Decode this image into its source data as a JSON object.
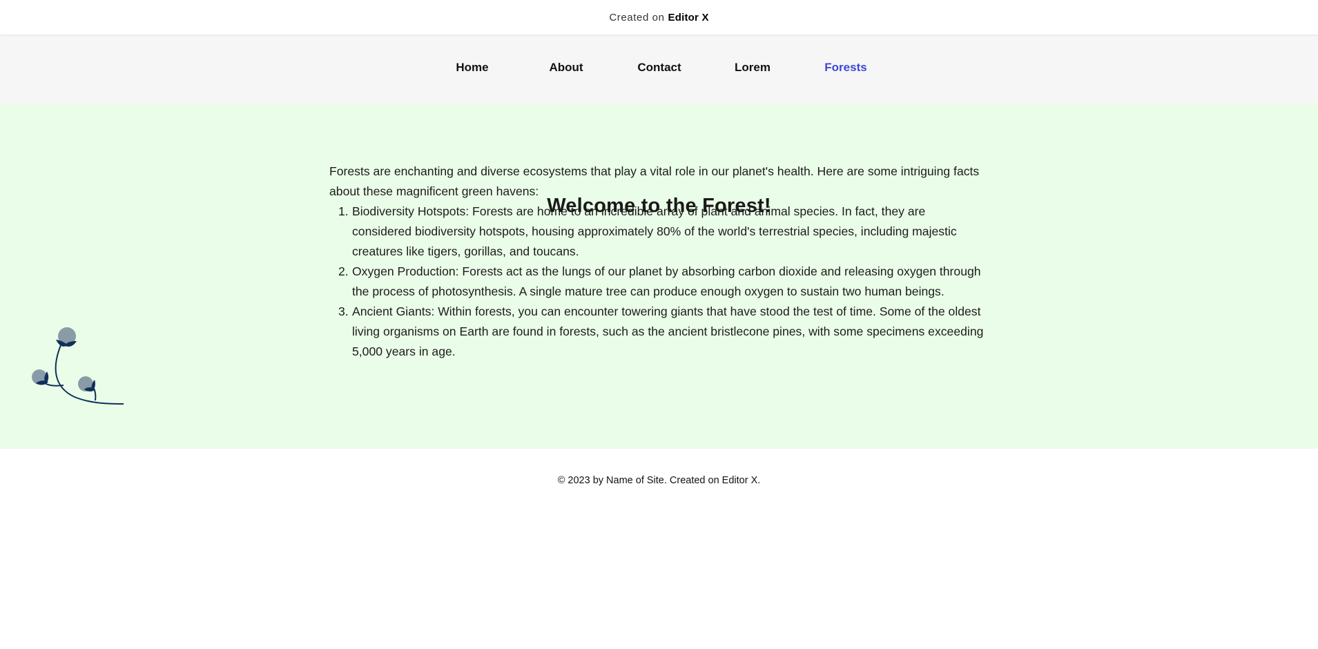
{
  "topbar": {
    "created_on": "Created on",
    "brand": "Editor X"
  },
  "nav": {
    "items": [
      {
        "label": "Home"
      },
      {
        "label": "About"
      },
      {
        "label": "Contact"
      },
      {
        "label": "Lorem"
      },
      {
        "label": "Forests"
      }
    ],
    "active": "Forests",
    "active_color": "#3d48d6"
  },
  "main": {
    "heading": "Welcome to the Forest!",
    "intro": "Forests are enchanting and diverse ecosystems that play a vital role in our planet's health. Here are some intriguing facts about these magnificent green havens:",
    "facts": [
      {
        "num": "1.",
        "text": "Biodiversity Hotspots: Forests are home to an incredible array of plant and animal species. In fact, they are considered biodiversity hotspots, housing approximately 80% of the world's terrestrial species, including majestic creatures like tigers, gorillas, and toucans."
      },
      {
        "num": "2.",
        "text": "Oxygen Production: Forests act as the lungs of our planet by absorbing carbon dioxide and releasing oxygen through the process of photosynthesis. A single mature tree can produce enough oxygen to sustain two human beings."
      },
      {
        "num": "3.",
        "text": "Ancient Giants: Within forests, you can encounter towering giants that have stood the test of time. Some of the oldest living organisms on Earth are found in forests, such as the ancient bristlecone pines, with some specimens exceeding 5,000 years in age."
      }
    ],
    "background_color": "#eafde8",
    "illustration": "plant-sprig-icon"
  },
  "footer": {
    "text": "© 2023 by Name of Site. Created on Editor X."
  }
}
